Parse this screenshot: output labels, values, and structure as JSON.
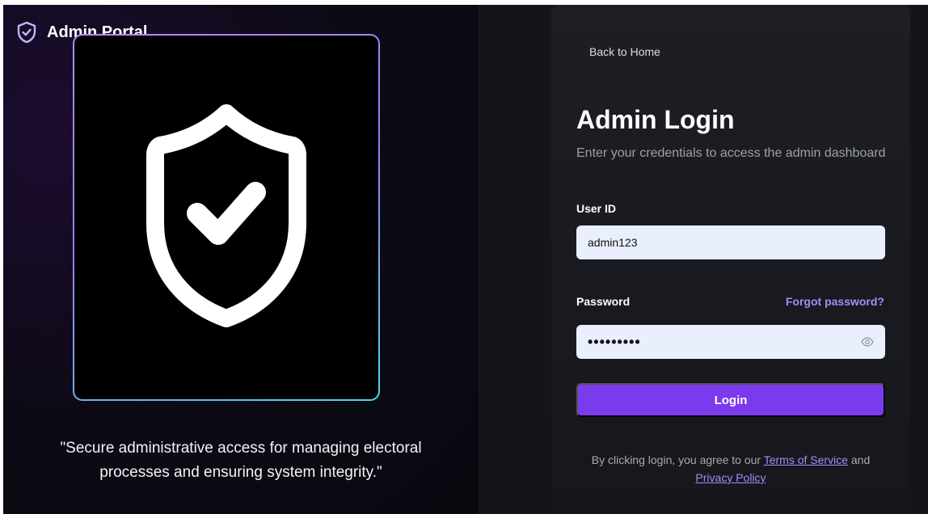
{
  "brand": {
    "title": "Admin Portal",
    "icon": "shield-check-icon"
  },
  "hero": {
    "icon": "shield-check-icon",
    "quote": "\"Secure administrative access for managing electoral processes and ensuring system integrity.\""
  },
  "login": {
    "back_link": "Back to Home",
    "title": "Admin Login",
    "subtitle": "Enter your credentials to access the admin dashboard",
    "user_label": "User ID",
    "user_value": "admin123",
    "password_label": "Password",
    "forgot_link": "Forgot password?",
    "password_value": "•••••••••",
    "eye_icon": "eye-icon",
    "button_label": "Login",
    "terms_prefix": "By clicking login, you agree to our",
    "terms_link": "Terms of Service",
    "terms_and": "and",
    "privacy_link": "Privacy Policy"
  },
  "colors": {
    "accent": "#7c3aed",
    "link": "#a78bfa",
    "input_bg": "#e9effd",
    "card_bg": "#1d1f24",
    "gradient_start": "#b38bf5",
    "gradient_end": "#4fd6e6"
  }
}
